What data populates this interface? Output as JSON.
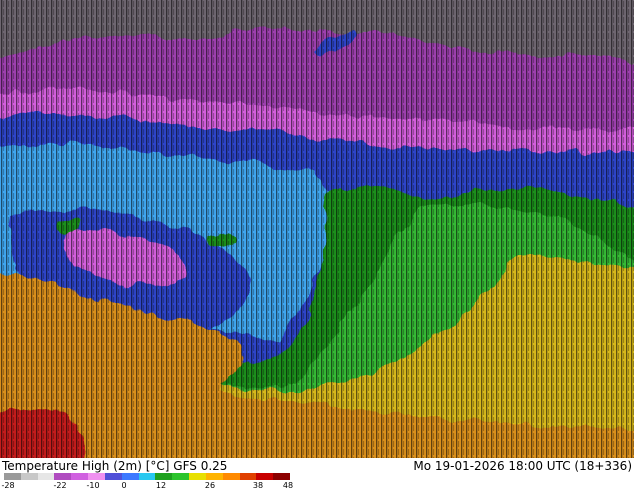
{
  "title": "Temperature High (2m) [°C] GFS 0.25",
  "timestamp": "Mo 19-01-2026 18:00 UTC (18+336)",
  "legend": {
    "ticks": [
      "-28",
      "-22",
      "-10",
      "0",
      "12",
      "26",
      "38",
      "48"
    ],
    "colors": [
      "#9a9a9a",
      "#c8c8c8",
      "#e6e6e6",
      "#b04cc0",
      "#d060e0",
      "#f090f0",
      "#5050d8",
      "#3c78ff",
      "#28c8f0",
      "#1ea01e",
      "#2cc42c",
      "#e8e000",
      "#ffb400",
      "#ff8a00",
      "#e04000",
      "#c80000",
      "#8c0000"
    ]
  },
  "map_colors": {
    "gray": "#6e6670",
    "purple": "#9d3fae",
    "magenta": "#d35fdc",
    "blue": "#2f44c8",
    "light_blue": "#3fa6ef",
    "green": "#1f8f1f",
    "light_green": "#35b935",
    "yellow": "#d7b81f",
    "orange": "#d98f1e",
    "red": "#c41f1f"
  }
}
